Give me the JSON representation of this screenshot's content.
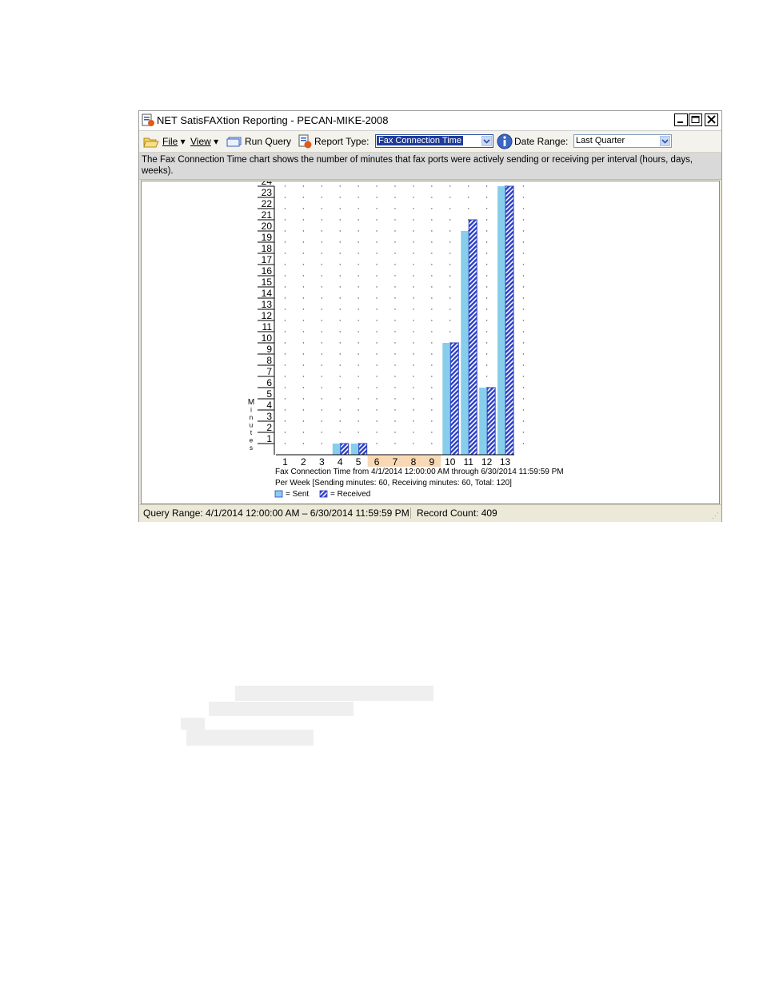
{
  "window": {
    "title": "NET SatisFAXtion Reporting - PECAN-MIKE-2008"
  },
  "toolbar": {
    "file_label": "File",
    "view_label": "View",
    "run_query_label": "Run Query",
    "report_type_label": "Report Type:",
    "report_type_value": "Fax Connection Time",
    "date_range_label": "Date Range:",
    "date_range_value": "Last Quarter"
  },
  "description": "The Fax Connection Time chart shows the number of minutes that fax ports were actively sending or receiving per interval (hours, days, weeks).",
  "chart_data": {
    "type": "bar",
    "categories": [
      "1",
      "2",
      "3",
      "4",
      "5",
      "6",
      "7",
      "8",
      "9",
      "10",
      "11",
      "12",
      "13"
    ],
    "highlighted_categories": [
      "6",
      "7",
      "8",
      "9"
    ],
    "series": [
      {
        "name": "Sent",
        "values": [
          0,
          0,
          0,
          1,
          1,
          0,
          0,
          0,
          0,
          10,
          20,
          6,
          24
        ]
      },
      {
        "name": "Received",
        "values": [
          0,
          0,
          0,
          1,
          1,
          0,
          0,
          0,
          0,
          10,
          21,
          6,
          24
        ]
      }
    ],
    "ylabel": "Minutes",
    "yticks": [
      1,
      2,
      3,
      4,
      5,
      6,
      7,
      8,
      9,
      10,
      11,
      12,
      13,
      14,
      15,
      16,
      17,
      18,
      19,
      20,
      21,
      22,
      23,
      24
    ],
    "ylim": [
      0,
      24
    ],
    "caption_line1": "Fax Connection Time from 4/1/2014 12:00:00 AM through 6/30/2014 11:59:59 PM",
    "caption_line2": "Per Week  [Sending minutes: 60, Receiving minutes: 60, Total: 120]",
    "legend_sent": "= Sent",
    "legend_received": "= Received",
    "colors": {
      "sent": "#87ceeb",
      "received": "#2c3fc8",
      "highlight": "#f9d9b5"
    },
    "grid": "dotted"
  },
  "status": {
    "query_range": "Query Range: 4/1/2014 12:00:00 AM – 6/30/2014 11:59:59 PM",
    "record_count": "Record Count: 409"
  }
}
